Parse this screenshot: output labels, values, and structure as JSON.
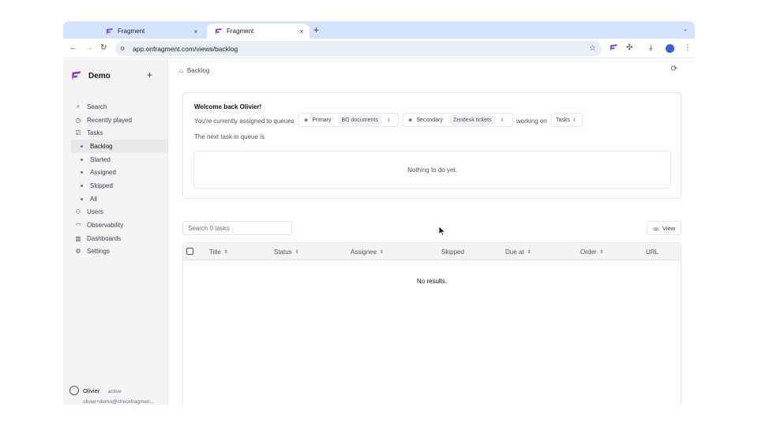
{
  "browser": {
    "tabs": [
      {
        "title": "Fragment",
        "active": false
      },
      {
        "title": "Fragment",
        "active": true
      }
    ],
    "new_tab": "+",
    "tab_close": "×",
    "url": "app.onfragment.com/views/backlog"
  },
  "sidebar": {
    "workspace": "Demo",
    "add": "+",
    "items": [
      {
        "label": "Search",
        "icon": "search-icon"
      },
      {
        "label": "Recently played",
        "icon": "history-icon"
      },
      {
        "label": "Tasks",
        "icon": "checkbox-icon"
      }
    ],
    "task_views": [
      {
        "label": "Backlog",
        "active": true
      },
      {
        "label": "Started",
        "active": false
      },
      {
        "label": "Assigned",
        "active": false
      },
      {
        "label": "Skipped",
        "active": false
      },
      {
        "label": "All",
        "active": false
      }
    ],
    "bottom_items": [
      {
        "label": "Users",
        "icon": "users-icon"
      },
      {
        "label": "Observability",
        "icon": "gauge-icon"
      },
      {
        "label": "Dashboards",
        "icon": "chart-icon"
      },
      {
        "label": "Settings",
        "icon": "gear-icon"
      }
    ],
    "user": {
      "name": "Olivier",
      "status": "active",
      "email": "olivier+demo@checkfragmen..."
    }
  },
  "main": {
    "breadcrumb": "Backlog",
    "welcome": "Welcome back Olivier!",
    "assigned_text": "You're currently assigned to queues",
    "primary": {
      "label": "Primary",
      "value": "BO documents"
    },
    "secondary": {
      "label": "Secondary",
      "value": "Zendesk tickets"
    },
    "working_on": "working on",
    "working_value": "Tasks",
    "next_task": "The next task in queue is",
    "empty_message": "Nothing to do yet.",
    "search_placeholder": "Search 0 tasks",
    "view_button": "View",
    "columns": [
      "Title",
      "Status",
      "Assignee",
      "Skipped",
      "Due at",
      "Order",
      "URL"
    ],
    "no_results": "No results."
  },
  "colors": {
    "accent": "#7c3aed",
    "sidebar_bg": "#f4f4f5",
    "tabstrip": "#d3e3fd"
  }
}
